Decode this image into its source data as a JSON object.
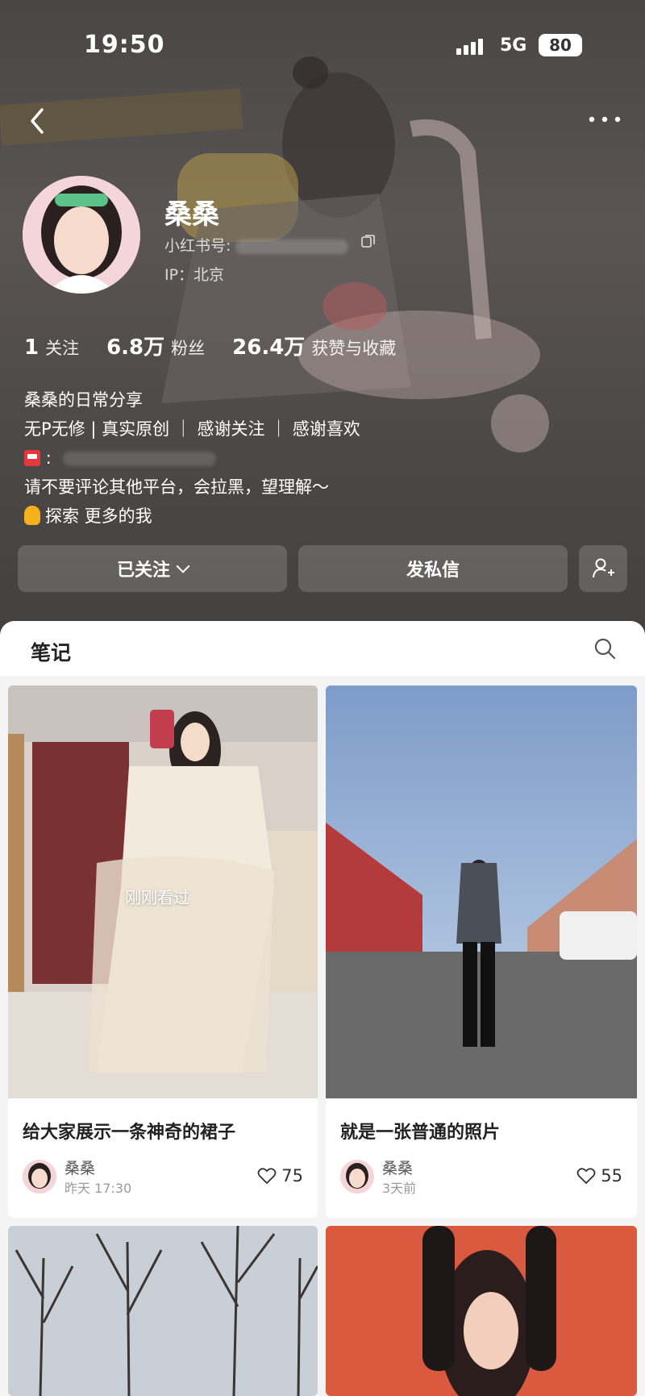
{
  "status_bar": {
    "time": "19:50",
    "network": "5G",
    "battery": "80"
  },
  "icons": {
    "back": "back-arrow-icon",
    "more": "more-dots-icon",
    "copy": "copy-icon",
    "search": "search-icon",
    "add_friend": "add-friend-icon",
    "like": "heart-icon",
    "mailbox": "mailbox-icon",
    "pointing": "pointing-down-icon"
  },
  "profile": {
    "name": "桑桑",
    "red_id_label": "小红书号:",
    "ip": "IP：北京",
    "stats": [
      {
        "num": "1",
        "label": "关注"
      },
      {
        "num": "6.8万",
        "label": "粉丝"
      },
      {
        "num": "26.4万",
        "label": "获赞与收藏"
      }
    ],
    "bio": {
      "line1": "桑桑的日常分享",
      "line2": "无P无修 | 真实原创 ｜ 感谢关注 ｜ 感谢喜欢",
      "line3_suffix": ":",
      "line4": "请不要评论其他平台，会拉黑，望理解～",
      "line5": "探索 更多的我"
    }
  },
  "actions": {
    "follow": "已关注",
    "message": "发私信"
  },
  "notes": {
    "title": "笔记",
    "viewed_label": "刚刚看过",
    "cards": [
      {
        "title": "给大家展示一条神奇的裙子",
        "author": "桑桑",
        "time": "昨天 17:30",
        "likes": "75"
      },
      {
        "title": "就是一张普通的照片",
        "author": "桑桑",
        "time": "3天前",
        "likes": "55"
      }
    ]
  },
  "colors": {
    "header_bg": "#4d4848",
    "panel_bg": "#f4f4f4",
    "bar_accent": "#c9a24a"
  }
}
